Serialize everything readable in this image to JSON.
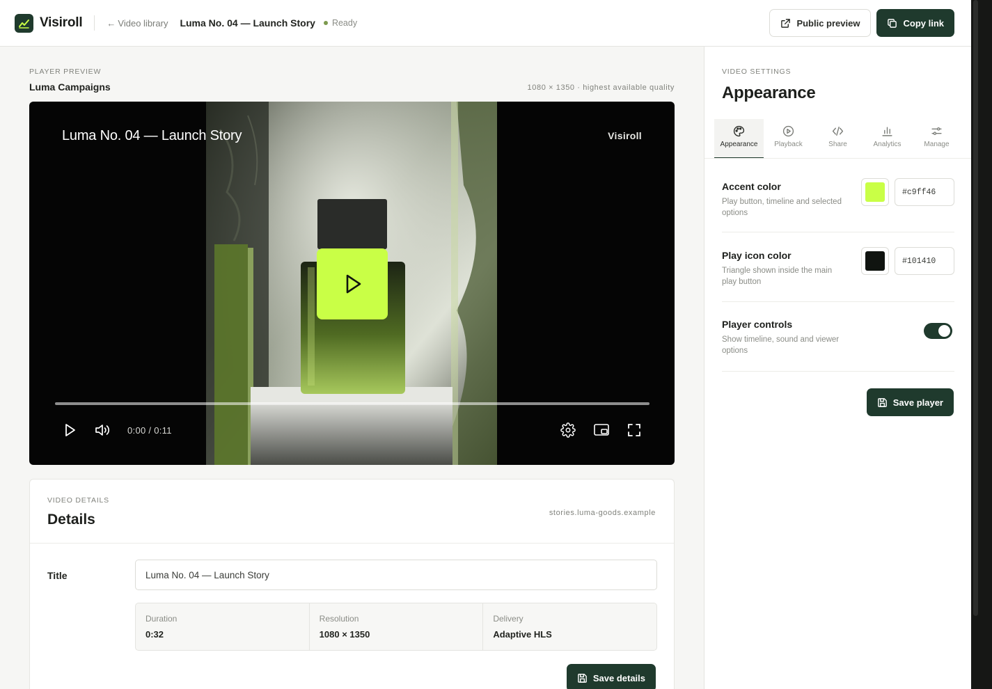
{
  "app": {
    "name": "Visiroll"
  },
  "topbar": {
    "back_label": "Video library",
    "video_title": "Luma No. 04 — Launch Story",
    "status": "Ready",
    "public_preview": "Public preview",
    "copy_link": "Copy link"
  },
  "preview": {
    "eyebrow": "PLAYER PREVIEW",
    "collection": "Luma Campaigns",
    "quality_note": "1080 × 1350 · highest available quality",
    "overlay_title": "Luma No. 04 — Launch Story",
    "watermark": "Visiroll",
    "time": "0:00 / 0:11",
    "progress": 0
  },
  "details": {
    "eyebrow": "VIDEO DETAILS",
    "heading": "Details",
    "domain": "stories.luma-goods.example",
    "title_label": "Title",
    "title_value": "Luma No. 04 — Launch Story",
    "meta": [
      {
        "label": "Duration",
        "value": "0:32"
      },
      {
        "label": "Resolution",
        "value": "1080 × 1350"
      },
      {
        "label": "Delivery",
        "value": "Adaptive HLS"
      }
    ],
    "save_label": "Save details"
  },
  "settings": {
    "eyebrow": "VIDEO SETTINGS",
    "heading": "Appearance",
    "tabs": [
      {
        "label": "Appearance",
        "icon": "palette-icon",
        "active": true
      },
      {
        "label": "Playback",
        "icon": "play-circle-icon",
        "active": false
      },
      {
        "label": "Share",
        "icon": "code-icon",
        "active": false
      },
      {
        "label": "Analytics",
        "icon": "bar-chart-icon",
        "active": false
      },
      {
        "label": "Manage",
        "icon": "sliders-icon",
        "active": false
      }
    ],
    "accent": {
      "title": "Accent color",
      "desc": "Play button, timeline and selected options",
      "hex": "#c9ff46"
    },
    "play_icon": {
      "title": "Play icon color",
      "desc": "Triangle shown inside the main play button",
      "hex": "#101410"
    },
    "controls": {
      "title": "Player controls",
      "desc": "Show timeline, sound and viewer options",
      "enabled": true
    },
    "save_label": "Save player"
  },
  "colors": {
    "brand": "#1f3a2d",
    "accent": "#c9ff46",
    "play_icon": "#101410",
    "status": "#7c9a4e"
  }
}
